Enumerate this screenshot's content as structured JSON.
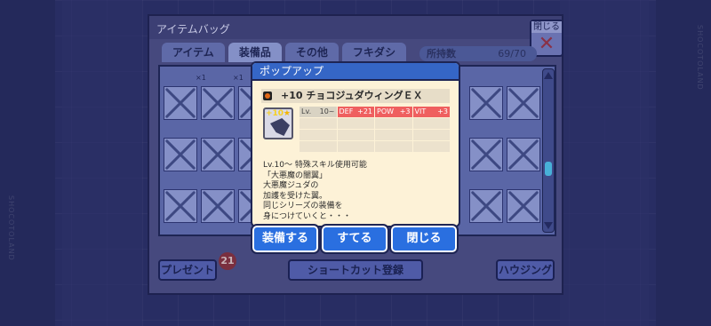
{
  "background_labels": {
    "left": "SHOCOTOLAND",
    "right": "SHOCOTOLAND"
  },
  "bag": {
    "title": "アイテムバッグ",
    "tabs": [
      "アイテム",
      "装備品",
      "その他",
      "フキダシ"
    ],
    "count_label": "所持数",
    "count_value": "69/70",
    "close_label": "閉じる",
    "close_symbol": "✕",
    "slot_counts": [
      "×1",
      "×1"
    ],
    "buttons": {
      "present": "プレゼント",
      "shortcut": "ショートカット登録",
      "housing": "ハウジング"
    },
    "present_badge": "21"
  },
  "popup": {
    "title": "ポップアップ",
    "item_name": "+10 チョコジュダウィングＥＸ",
    "icon_plus": "+10",
    "icon_star": "★",
    "stats": [
      {
        "label": "Lv.",
        "value": "10~",
        "style": "gray"
      },
      {
        "label": "DEF",
        "value": "+21",
        "style": "red"
      },
      {
        "label": "POW",
        "value": "+3",
        "style": "red"
      },
      {
        "label": "VIT",
        "value": "+3",
        "style": "red"
      }
    ],
    "description": "Lv.10～ 特殊スキル使用可能\n「大悪魔の闇翼」\n大悪魔ジュダの\n加護を受けた翼。\n同じシリーズの装備を\n身につけていくと・・・",
    "buttons": {
      "equip": "装備する",
      "discard": "すてる",
      "close": "閉じる"
    }
  },
  "colors": {
    "popup_header": "#3566c6",
    "action_button": "#2a6fe0",
    "stat_highlight": "#ef5f5f"
  }
}
